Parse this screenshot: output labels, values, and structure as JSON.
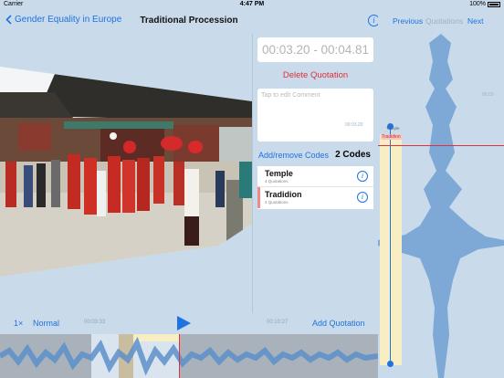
{
  "status": {
    "carrier": "Carrier",
    "time": "4:47 PM",
    "battery": "100%"
  },
  "nav": {
    "back_label": "Gender Equality in Europe",
    "title": "Traditional Procession",
    "info_icon": "info-icon"
  },
  "quote_nav": {
    "previous": "Previous",
    "title": "Quotations",
    "next": "Next"
  },
  "quotation": {
    "time_range": "00:03.20 - 00:04.81",
    "delete_label": "Delete Quotation",
    "comment_placeholder": "Tap to edit Comment",
    "add_remove_label": "Add/remove Codes",
    "codes_count": "2 Codes"
  },
  "codes": [
    {
      "name": "Temple",
      "sub": "4 Quotations",
      "color": "#ffffff"
    },
    {
      "name": "Tradidion",
      "sub": "4 Quotations",
      "color": "#f08a86"
    }
  ],
  "waveform_labels": {
    "marker_top_1": "Temple",
    "marker_top_2": "Tradidion",
    "time_1": "00:03.20",
    "time_2": "00:03"
  },
  "controls": {
    "speed": "1×",
    "mode": "Normal",
    "time_left": "00:03:33",
    "time_right": "00:10:27",
    "add_label": "Add Quotation"
  },
  "colors": {
    "accent": "#1f72e0",
    "delete": "#e0303a",
    "wave": "#7ea8d6",
    "marker": "#f7eec4",
    "playhead": "#e0303a"
  }
}
